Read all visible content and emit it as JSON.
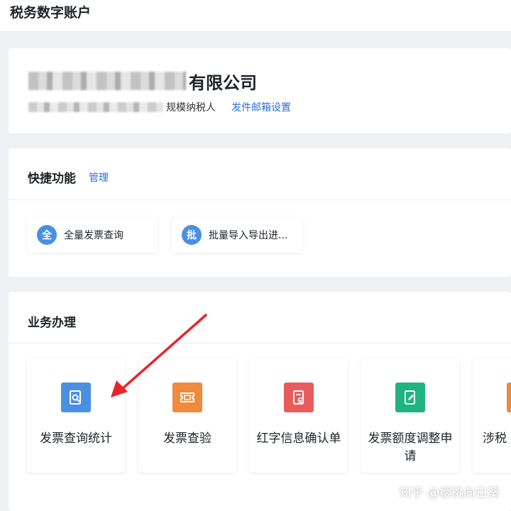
{
  "header": {
    "title": "税务数字账户"
  },
  "company": {
    "name_visible": "有限公司",
    "taxpayer_type_visible": "规模纳税人",
    "mail_setting_link": "发件邮箱设置"
  },
  "quick": {
    "title": "快捷功能",
    "manage_link": "管理",
    "items": [
      {
        "badge": "全",
        "label": "全量发票查询"
      },
      {
        "badge": "批",
        "label": "批量导入导出进..."
      }
    ]
  },
  "business": {
    "title": "业务办理",
    "tiles": [
      {
        "label": "发票查询统计",
        "color": "#4a90e2",
        "icon": "invoice-search-icon"
      },
      {
        "label": "发票查验",
        "color": "#f08a3c",
        "icon": "ticket-icon"
      },
      {
        "label": "红字信息确认单",
        "color": "#e85c5c",
        "icon": "document-check-icon"
      },
      {
        "label": "发票额度调整申请",
        "color": "#1fb37f",
        "icon": "edit-document-icon"
      },
      {
        "label": "涉税",
        "color": "#f08a3c",
        "icon": "tax-icon"
      }
    ]
  },
  "annotation": {
    "arrow_color": "#e8242a"
  },
  "watermark": {
    "text": "知乎 @樱桃向日葵"
  }
}
